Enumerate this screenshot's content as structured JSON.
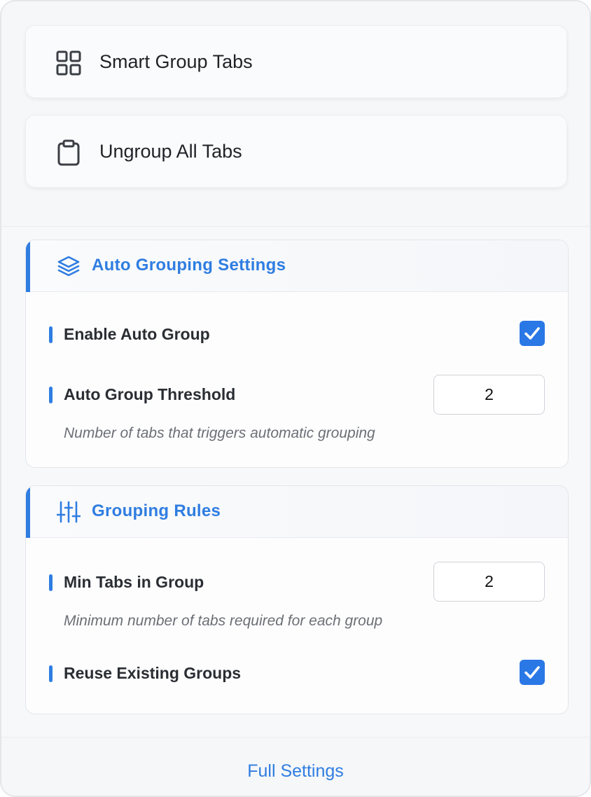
{
  "actions": {
    "smart_group": {
      "label": "Smart Group Tabs",
      "icon": "grid-icon"
    },
    "ungroup_all": {
      "label": "Ungroup All Tabs",
      "icon": "clipboard-icon"
    }
  },
  "auto_grouping": {
    "title": "Auto Grouping Settings",
    "icon": "layers-icon",
    "enable_auto_group": {
      "label": "Enable Auto Group",
      "checked": true
    },
    "threshold": {
      "label": "Auto Group Threshold",
      "value": "2",
      "hint": "Number of tabs that triggers automatic grouping"
    }
  },
  "grouping_rules": {
    "title": "Grouping Rules",
    "icon": "sliders-icon",
    "min_tabs": {
      "label": "Min Tabs in Group",
      "value": "2",
      "hint": "Minimum number of tabs required for each group"
    },
    "reuse_groups": {
      "label": "Reuse Existing Groups",
      "checked": true
    }
  },
  "footer": {
    "link": "Full Settings"
  },
  "colors": {
    "accent": "#2f7de1",
    "checkbox": "#2a77e6"
  }
}
